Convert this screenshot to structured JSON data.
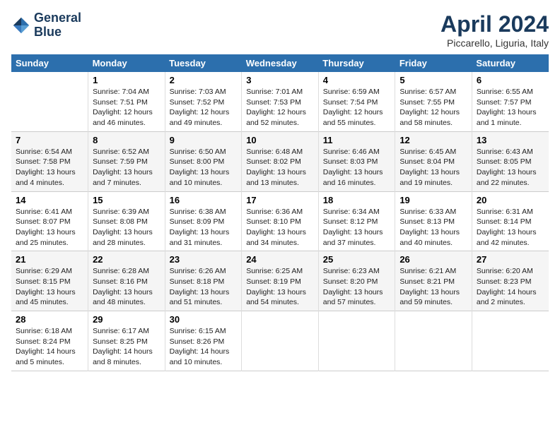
{
  "logo": {
    "line1": "General",
    "line2": "Blue"
  },
  "title": "April 2024",
  "location": "Piccarello, Liguria, Italy",
  "weekdays": [
    "Sunday",
    "Monday",
    "Tuesday",
    "Wednesday",
    "Thursday",
    "Friday",
    "Saturday"
  ],
  "weeks": [
    [
      {
        "day": "",
        "info": ""
      },
      {
        "day": "1",
        "info": "Sunrise: 7:04 AM\nSunset: 7:51 PM\nDaylight: 12 hours\nand 46 minutes."
      },
      {
        "day": "2",
        "info": "Sunrise: 7:03 AM\nSunset: 7:52 PM\nDaylight: 12 hours\nand 49 minutes."
      },
      {
        "day": "3",
        "info": "Sunrise: 7:01 AM\nSunset: 7:53 PM\nDaylight: 12 hours\nand 52 minutes."
      },
      {
        "day": "4",
        "info": "Sunrise: 6:59 AM\nSunset: 7:54 PM\nDaylight: 12 hours\nand 55 minutes."
      },
      {
        "day": "5",
        "info": "Sunrise: 6:57 AM\nSunset: 7:55 PM\nDaylight: 12 hours\nand 58 minutes."
      },
      {
        "day": "6",
        "info": "Sunrise: 6:55 AM\nSunset: 7:57 PM\nDaylight: 13 hours\nand 1 minute."
      }
    ],
    [
      {
        "day": "7",
        "info": "Sunrise: 6:54 AM\nSunset: 7:58 PM\nDaylight: 13 hours\nand 4 minutes."
      },
      {
        "day": "8",
        "info": "Sunrise: 6:52 AM\nSunset: 7:59 PM\nDaylight: 13 hours\nand 7 minutes."
      },
      {
        "day": "9",
        "info": "Sunrise: 6:50 AM\nSunset: 8:00 PM\nDaylight: 13 hours\nand 10 minutes."
      },
      {
        "day": "10",
        "info": "Sunrise: 6:48 AM\nSunset: 8:02 PM\nDaylight: 13 hours\nand 13 minutes."
      },
      {
        "day": "11",
        "info": "Sunrise: 6:46 AM\nSunset: 8:03 PM\nDaylight: 13 hours\nand 16 minutes."
      },
      {
        "day": "12",
        "info": "Sunrise: 6:45 AM\nSunset: 8:04 PM\nDaylight: 13 hours\nand 19 minutes."
      },
      {
        "day": "13",
        "info": "Sunrise: 6:43 AM\nSunset: 8:05 PM\nDaylight: 13 hours\nand 22 minutes."
      }
    ],
    [
      {
        "day": "14",
        "info": "Sunrise: 6:41 AM\nSunset: 8:07 PM\nDaylight: 13 hours\nand 25 minutes."
      },
      {
        "day": "15",
        "info": "Sunrise: 6:39 AM\nSunset: 8:08 PM\nDaylight: 13 hours\nand 28 minutes."
      },
      {
        "day": "16",
        "info": "Sunrise: 6:38 AM\nSunset: 8:09 PM\nDaylight: 13 hours\nand 31 minutes."
      },
      {
        "day": "17",
        "info": "Sunrise: 6:36 AM\nSunset: 8:10 PM\nDaylight: 13 hours\nand 34 minutes."
      },
      {
        "day": "18",
        "info": "Sunrise: 6:34 AM\nSunset: 8:12 PM\nDaylight: 13 hours\nand 37 minutes."
      },
      {
        "day": "19",
        "info": "Sunrise: 6:33 AM\nSunset: 8:13 PM\nDaylight: 13 hours\nand 40 minutes."
      },
      {
        "day": "20",
        "info": "Sunrise: 6:31 AM\nSunset: 8:14 PM\nDaylight: 13 hours\nand 42 minutes."
      }
    ],
    [
      {
        "day": "21",
        "info": "Sunrise: 6:29 AM\nSunset: 8:15 PM\nDaylight: 13 hours\nand 45 minutes."
      },
      {
        "day": "22",
        "info": "Sunrise: 6:28 AM\nSunset: 8:16 PM\nDaylight: 13 hours\nand 48 minutes."
      },
      {
        "day": "23",
        "info": "Sunrise: 6:26 AM\nSunset: 8:18 PM\nDaylight: 13 hours\nand 51 minutes."
      },
      {
        "day": "24",
        "info": "Sunrise: 6:25 AM\nSunset: 8:19 PM\nDaylight: 13 hours\nand 54 minutes."
      },
      {
        "day": "25",
        "info": "Sunrise: 6:23 AM\nSunset: 8:20 PM\nDaylight: 13 hours\nand 57 minutes."
      },
      {
        "day": "26",
        "info": "Sunrise: 6:21 AM\nSunset: 8:21 PM\nDaylight: 13 hours\nand 59 minutes."
      },
      {
        "day": "27",
        "info": "Sunrise: 6:20 AM\nSunset: 8:23 PM\nDaylight: 14 hours\nand 2 minutes."
      }
    ],
    [
      {
        "day": "28",
        "info": "Sunrise: 6:18 AM\nSunset: 8:24 PM\nDaylight: 14 hours\nand 5 minutes."
      },
      {
        "day": "29",
        "info": "Sunrise: 6:17 AM\nSunset: 8:25 PM\nDaylight: 14 hours\nand 8 minutes."
      },
      {
        "day": "30",
        "info": "Sunrise: 6:15 AM\nSunset: 8:26 PM\nDaylight: 14 hours\nand 10 minutes."
      },
      {
        "day": "",
        "info": ""
      },
      {
        "day": "",
        "info": ""
      },
      {
        "day": "",
        "info": ""
      },
      {
        "day": "",
        "info": ""
      }
    ]
  ]
}
